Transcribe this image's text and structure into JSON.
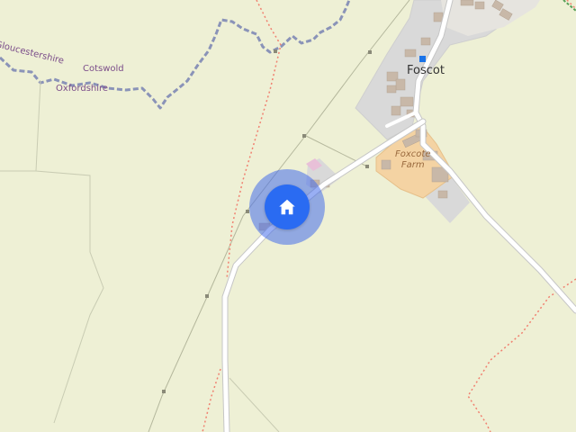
{
  "map": {
    "region_labels": {
      "cotswold": "Cotswold",
      "gloucestershire": "Gloucestershire",
      "oxfordshire": "Oxfordshire"
    },
    "place_label": "Foscot",
    "farm_label": {
      "line1": "Foxcote",
      "line2": "Farm"
    },
    "home_marker": {
      "icon": "home-icon",
      "color": "#2a6bf2"
    },
    "colors": {
      "land": "#eef0d5",
      "residential": "#d9d9d9",
      "farmyard": "#f4d3a3",
      "road": "#ffffff",
      "boundary": "#8a93b8",
      "footpath": "#f08070"
    }
  }
}
